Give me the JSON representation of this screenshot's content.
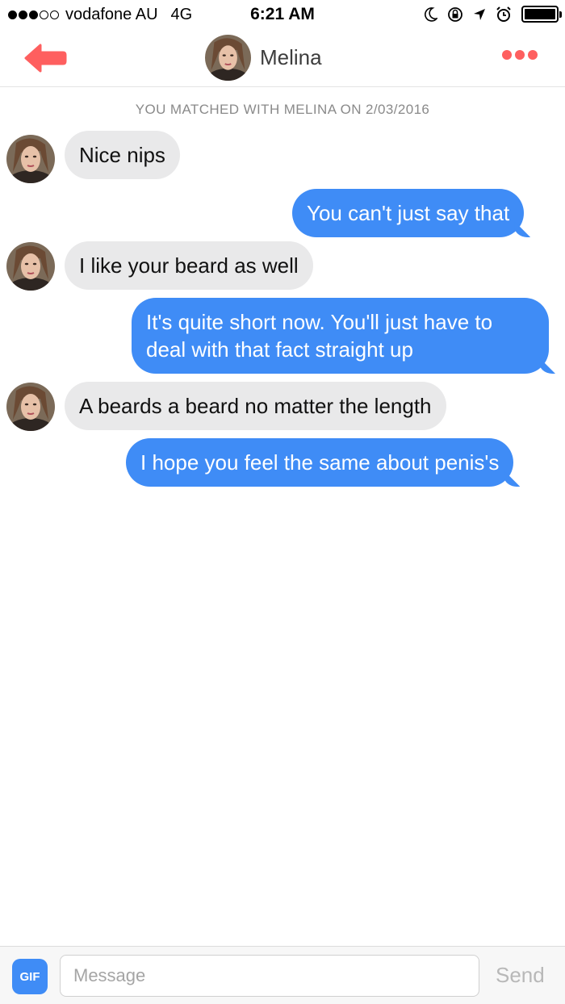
{
  "status_bar": {
    "carrier": "vodafone AU",
    "network": "4G",
    "time": "6:21 AM",
    "signal_bars_filled": 3,
    "signal_bars_total": 5,
    "battery_level": 1.0,
    "icons": [
      "moon-icon",
      "rotation-lock-icon",
      "location-arrow-icon",
      "alarm-icon",
      "battery-icon"
    ]
  },
  "header": {
    "name": "Melina",
    "back_icon": "back-arrow-icon",
    "more_icon": "more-dots-icon",
    "accent_color": "#fe5f5f"
  },
  "match_notice": "YOU MATCHED WITH MELINA ON 2/03/2016",
  "messages": [
    {
      "from": "them",
      "text": "Nice nips"
    },
    {
      "from": "me",
      "text": "You can't just say that"
    },
    {
      "from": "them",
      "text": "I like your beard as well"
    },
    {
      "from": "me",
      "text": "It's quite short now. You'll just have to deal with that fact straight up"
    },
    {
      "from": "them",
      "text": "A beards a beard no matter the length"
    },
    {
      "from": "me",
      "text": "I hope you feel the same about penis's"
    }
  ],
  "composer": {
    "gif_label": "GIF",
    "placeholder": "Message",
    "value": "",
    "send_label": "Send"
  },
  "colors": {
    "outgoing_bubble": "#3f8cf6",
    "incoming_bubble": "#e9e9ea"
  }
}
